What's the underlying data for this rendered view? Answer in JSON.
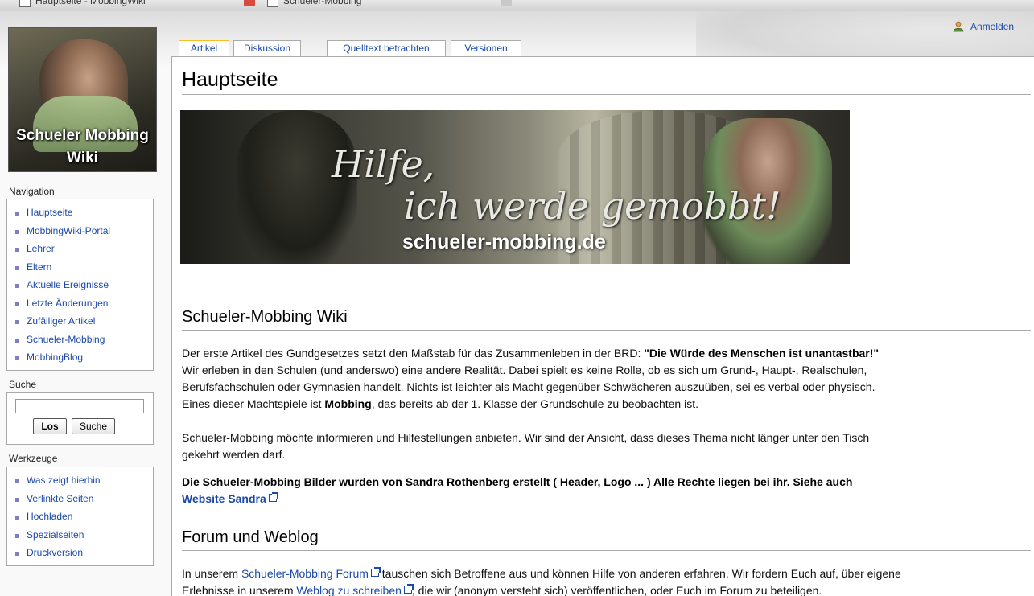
{
  "browser": {
    "tabs": [
      {
        "label": "Hauptseite - MobbingWiki"
      },
      {
        "label": "Schueler-Mobbing"
      }
    ]
  },
  "header": {
    "login_label": "Anmelden"
  },
  "logo": {
    "line1": "Schueler Mobbing",
    "line2": "Wiki"
  },
  "sidebar": {
    "navigation_title": "Navigation",
    "navigation": [
      {
        "label": "Hauptseite"
      },
      {
        "label": "MobbingWiki-Portal"
      },
      {
        "label": "Lehrer"
      },
      {
        "label": "Eltern"
      },
      {
        "label": "Aktuelle Ereignisse"
      },
      {
        "label": "Letzte Änderungen"
      },
      {
        "label": "Zufälliger Artikel"
      },
      {
        "label": "Schueler-Mobbing"
      },
      {
        "label": "MobbingBlog"
      }
    ],
    "search_title": "Suche",
    "search_value": "",
    "go_button": "Los",
    "search_button": "Suche",
    "tools_title": "Werkzeuge",
    "tools": [
      {
        "label": "Was zeigt hierhin"
      },
      {
        "label": "Verlinkte Seiten"
      },
      {
        "label": "Hochladen"
      },
      {
        "label": "Spezialseiten"
      },
      {
        "label": "Druckversion"
      }
    ]
  },
  "tabs": [
    {
      "label": "Artikel",
      "selected": true
    },
    {
      "label": "Diskussion",
      "selected": false
    },
    {
      "label": "Quelltext betrachten",
      "selected": false
    },
    {
      "label": "Versionen",
      "selected": false
    }
  ],
  "main": {
    "page_title": "Hauptseite",
    "banner": {
      "script_line1": "Hilfe,",
      "script_line2": "ich werde gemobbt!",
      "domain": "schueler-mobbing.de"
    },
    "section1": {
      "heading": "Schueler-Mobbing Wiki",
      "p1_before": "Der erste Artikel des Gundgesetzes setzt den Maßstab für das Zusammenleben in der BRD: ",
      "p1_bold": "\"Die Würde des Menschen ist unantastbar!\"",
      "p1_line2": "Wir erleben in den Schulen (und anderswo) eine andere Realität. Dabei spielt es keine Rolle, ob es sich um Grund-, Haupt-, Realschulen,",
      "p1_line3": "Berufsfachschulen oder Gymnasien handelt. Nichts ist leichter als Macht gegenüber Schwächeren auszuüben, sei es verbal oder physisch.",
      "p1_line4_before": "Eines dieser Machtspiele ist ",
      "p1_line4_bold": "Mobbing",
      "p1_line4_after": ", das bereits ab der 1. Klasse der Grundschule zu beobachten ist.",
      "p2_line1": "Schueler-Mobbing möchte informieren und Hilfestellungen anbieten. Wir sind der Ansicht, dass dieses Thema nicht länger unter den Tisch",
      "p2_line2": "gekehrt werden darf.",
      "p3_bold": "Die Schueler-Mobbing Bilder wurden von Sandra Rothenberg erstellt ( Header, Logo ... ) Alle Rechte liegen bei ihr. Siehe auch",
      "p3_link": "Website Sandra"
    },
    "section2": {
      "heading": "Forum und Weblog",
      "p1_before": "In unserem ",
      "p1_link": "Schueler-Mobbing Forum",
      "p1_after": " tauschen sich Betroffene aus und können Hilfe von anderen erfahren. Wir fordern Euch auf, über eigene",
      "p2_before": "Erlebnisse in unserem ",
      "p2_link": "Weblog zu schreiben",
      "p2_after": ", die wir (anonym versteht sich) veröffentlichen, oder Euch im Forum zu beteiligen."
    }
  }
}
